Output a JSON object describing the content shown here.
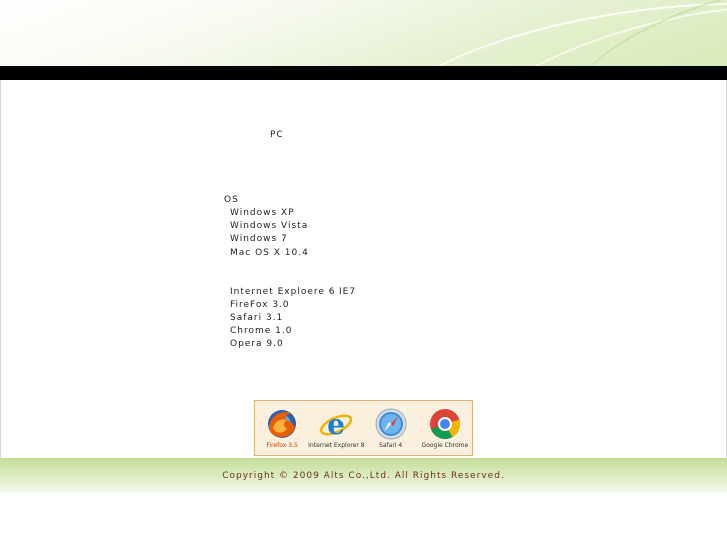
{
  "page": {
    "pc_label": "PC"
  },
  "os": {
    "heading": "OS",
    "items": [
      "Windows XP",
      "Windows Vista",
      "Windows 7",
      "Mac OS X 10.4"
    ]
  },
  "browsers": {
    "items": [
      "Internet Exploere 6",
      "FireFox 3.0",
      "Safari 3.1",
      "Chrome 1.0",
      "Opera 9.0"
    ],
    "ie_note": "IE7"
  },
  "badges": [
    {
      "name": "firefox-icon",
      "label": "Firefox 3.5",
      "color": "#e66000"
    },
    {
      "name": "internet-explorer-icon",
      "label": "Internet Explorer 8",
      "color": "#1a7fd6"
    },
    {
      "name": "safari-icon",
      "label": "Safari 4",
      "color": "#3a8fd8"
    },
    {
      "name": "chrome-icon",
      "label": "Google Chrome",
      "color": "#db4437"
    }
  ],
  "footer": {
    "copyright": "Copyright © 2009 Alts Co.,Ltd. All Rights Reserved."
  },
  "colors": {
    "topbar": "#000000",
    "footer_text": "#6b3410",
    "header_green": "#d8ebb9"
  }
}
